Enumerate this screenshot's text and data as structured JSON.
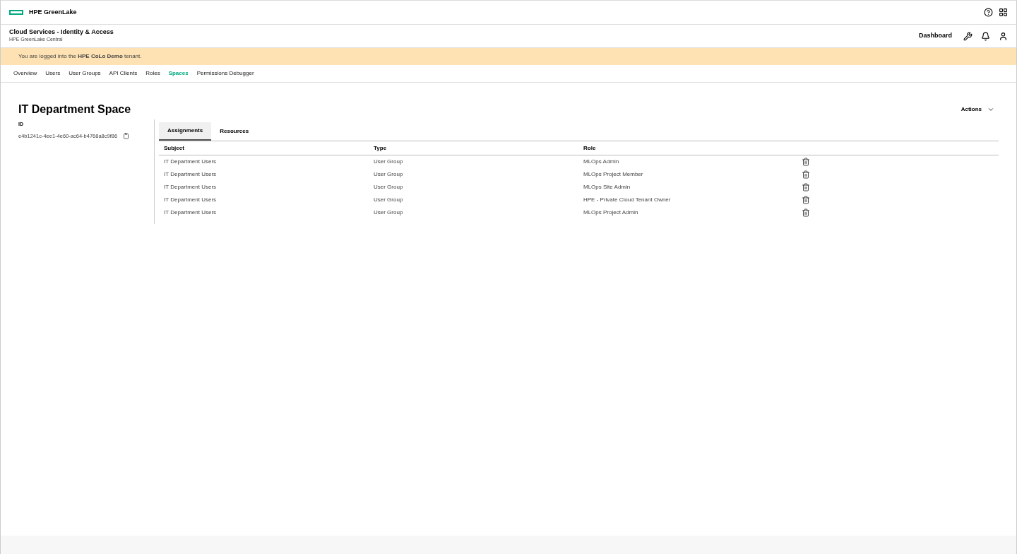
{
  "brand": "HPE GreenLake",
  "app": {
    "title": "Cloud Services - Identity & Access",
    "subtitle": "HPE GreenLake Central",
    "dashboard": "Dashboard"
  },
  "banner": "You are logged into the **HPE CoLo Demo** tenant.",
  "nav": [
    {
      "label": "Overview",
      "selected": false
    },
    {
      "label": "Users",
      "selected": false
    },
    {
      "label": "User Groups",
      "selected": false
    },
    {
      "label": "API Clients",
      "selected": false
    },
    {
      "label": "Roles",
      "selected": false
    },
    {
      "label": "Spaces",
      "selected": true
    },
    {
      "label": "Permissions Debugger",
      "selected": false
    }
  ],
  "page": {
    "title": "IT Department Space",
    "actions": "Actions",
    "id_label": "ID",
    "id_value": "e4b1241c-4ee1-4e60-ac64-b4768a8c9f86"
  },
  "tabs": [
    {
      "label": "Assignments",
      "selected": true
    },
    {
      "label": "Resources",
      "selected": false
    }
  ],
  "table": {
    "columns": [
      "Subject",
      "Type",
      "Role"
    ],
    "rows": [
      [
        "IT Department Users",
        "User Group",
        "MLOps Admin"
      ],
      [
        "IT Department Users",
        "User Group",
        "MLOps Project Member"
      ],
      [
        "IT Department Users",
        "User Group",
        "MLOps Site Admin"
      ],
      [
        "IT Department Users",
        "User Group",
        "HPE - Private Cloud Tenant Owner"
      ],
      [
        "IT Department Users",
        "User Group",
        "MLOps Project Admin"
      ]
    ]
  }
}
